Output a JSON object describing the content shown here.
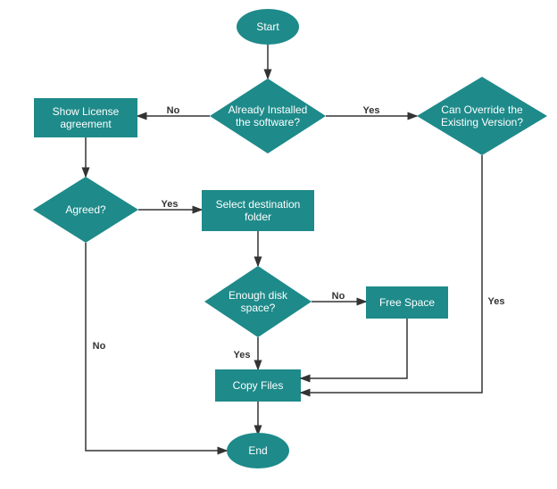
{
  "colors": {
    "node": "#1e8a8a",
    "text": "#ffffff",
    "edge": "#333333"
  },
  "nodes": {
    "start": "Start",
    "already_installed_l1": "Already Installed",
    "already_installed_l2": "the software?",
    "show_license_l1": "Show License",
    "show_license_l2": "agreement",
    "can_override_l1": "Can Override the",
    "can_override_l2": "Existing Version?",
    "agreed": "Agreed?",
    "select_dest_l1": "Select destination",
    "select_dest_l2": "folder",
    "enough_disk_l1": "Enough disk",
    "enough_disk_l2": "space?",
    "free_space": "Free Space",
    "copy_files": "Copy Files",
    "end": "End"
  },
  "edges": {
    "no": "No",
    "yes": "Yes"
  }
}
